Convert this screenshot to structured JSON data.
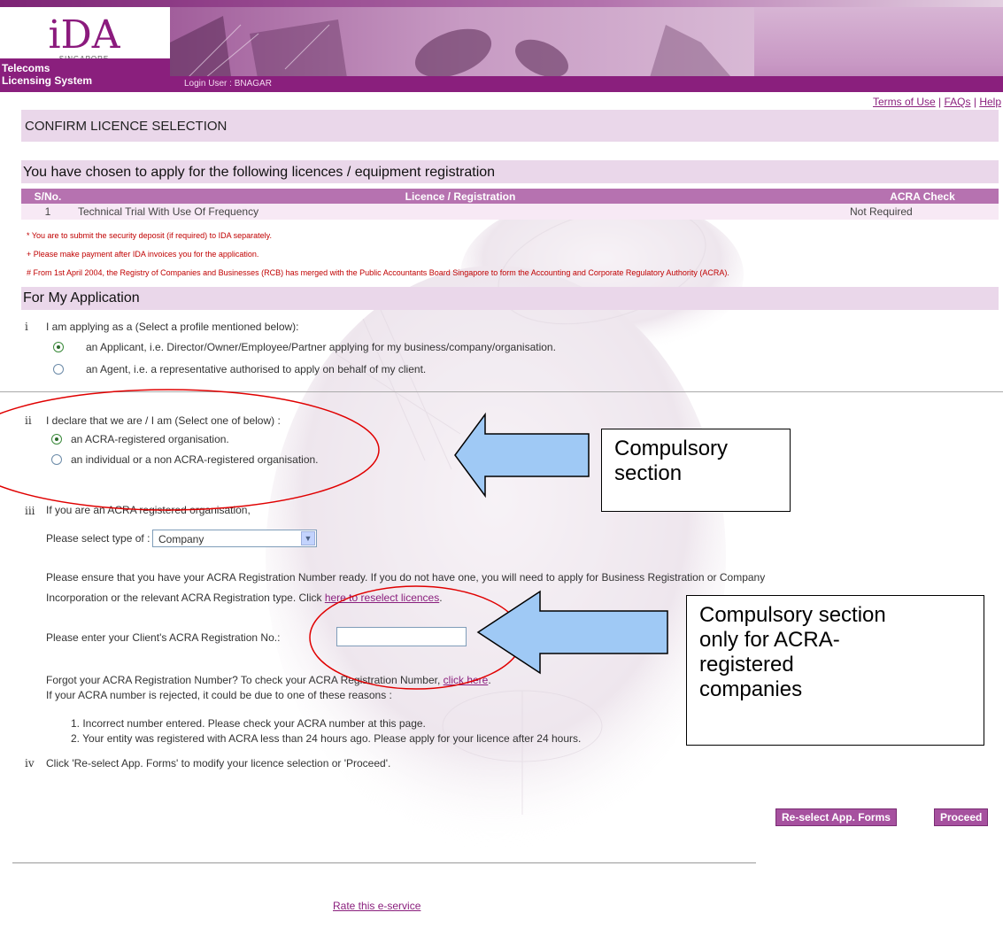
{
  "header": {
    "logo_mark": "iDA",
    "logo_sub": "SINGAPORE",
    "system_name_line1": "Telecoms",
    "system_name_line2": "Licensing System",
    "login_user": "Login User : BNAGAR"
  },
  "top_links": {
    "terms": "Terms of Use",
    "faqs": "FAQs",
    "help": "Help",
    "sep": "|"
  },
  "page_title": "CONFIRM LICENCE SELECTION",
  "licences": {
    "heading": "You have chosen to apply for the following licences / equipment registration",
    "columns": [
      "S/No.",
      "Licence / Registration",
      "ACRA Check"
    ],
    "rows": [
      {
        "sno": "1",
        "licence": "Technical Trial With Use Of Frequency",
        "acra": "Not Required"
      }
    ],
    "notes": [
      "* You are to submit the security deposit (if required) to IDA separately.",
      "+ Please make payment after IDA invoices you for the application.",
      "# From 1st April 2004, the Registry of Companies and Businesses (RCB) has merged with the Public Accountants Board Singapore to form the Accounting and Corporate Regulatory Authority (ACRA)."
    ]
  },
  "application": {
    "heading": "For My Application",
    "q1": {
      "num": "i",
      "text": "I am applying as a (Select a profile mentioned below):",
      "options": [
        {
          "label": "an Applicant, i.e. Director/Owner/Employee/Partner applying for my business/company/organisation.",
          "checked": true
        },
        {
          "label": "an Agent, i.e. a representative authorised to apply on behalf of my client.",
          "checked": false
        }
      ]
    },
    "q2": {
      "num": "ii",
      "text": "I declare that we are / I am (Select one of below) :",
      "options": [
        {
          "label": "an ACRA-registered organisation.",
          "checked": true
        },
        {
          "label": "an individual or a non ACRA-registered organisation.",
          "checked": false
        }
      ]
    },
    "q3": {
      "num": "iii",
      "text": "If you are an ACRA registered organisation,",
      "select_label": "Please select type of :",
      "select_value": "Company",
      "ensure_line1": "Please ensure that you have your ACRA Registration Number ready. If you do not have one, you will need to apply for Business Registration or Company",
      "ensure_line2": "Incorporation or the relevant ACRA Registration type. Click ",
      "reselect_link": "here to reselect licences",
      "ensure_end": ".",
      "input_label": "Please enter your Client's ACRA Registration No.:",
      "input_value": "",
      "forgot_text": "Forgot your ACRA Registration Number? To check your ACRA Registration Number, ",
      "forgot_link": "click here",
      "forgot_end": ".",
      "reject_text": "If your ACRA number is rejected, it could be due to one of these reasons :",
      "reasons": [
        "1.  Incorrect number entered. Please check your ACRA number at this page.",
        "2.  Your entity was registered with ACRA less than 24 hours ago. Please apply for your licence after 24 hours."
      ]
    },
    "q4": {
      "num": "iv",
      "text": "Click 'Re-select App. Forms' to modify your licence selection or 'Proceed'."
    }
  },
  "buttons": {
    "reselect": "Re-select App. Forms",
    "proceed": "Proceed"
  },
  "footer": {
    "rate_link": "Rate this e-service"
  },
  "annotations": {
    "callout1": [
      "Compulsory",
      "section"
    ],
    "callout2": [
      "Compulsory section",
      "only for ACRA-",
      "registered",
      "companies"
    ]
  },
  "colors": {
    "brand_purple": "#8a1f7d",
    "table_header": "#b672b0",
    "section_bar": "#ead7ea",
    "note_red": "#c00000",
    "arrow_fill": "#9fc9f5",
    "ellipse": "#e00000"
  }
}
